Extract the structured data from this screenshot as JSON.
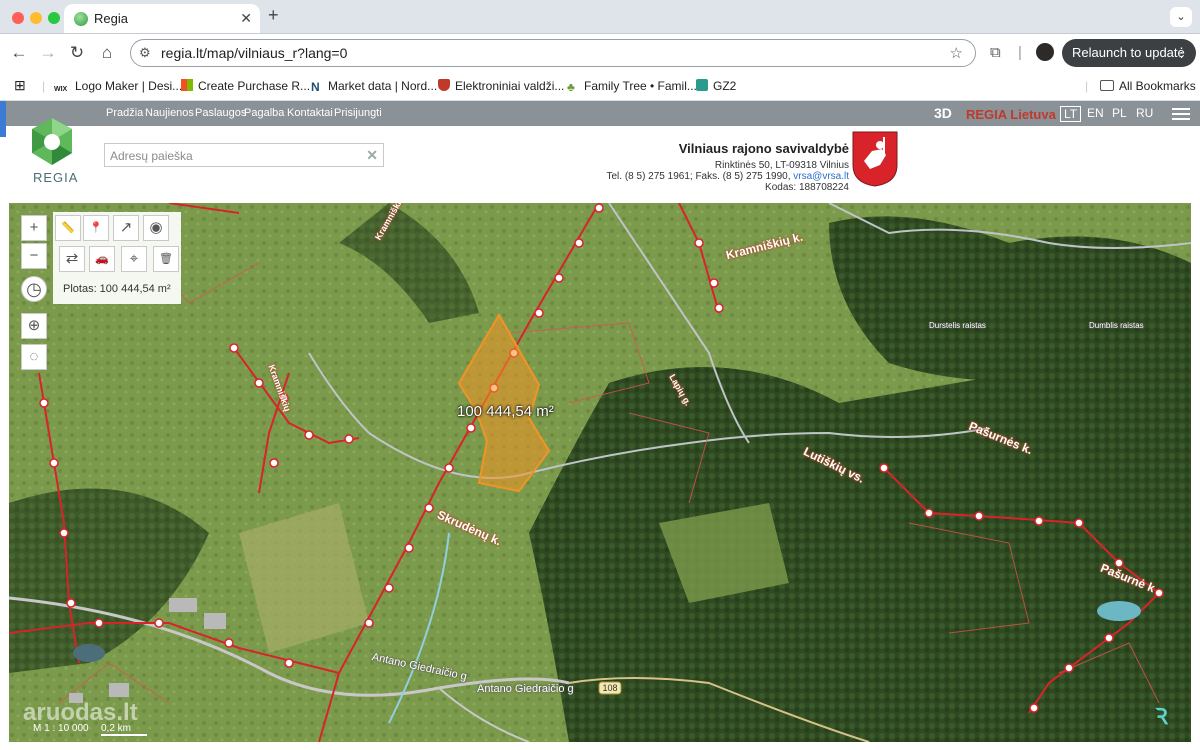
{
  "browser": {
    "tab_title": "Regia",
    "tab_close": "✕",
    "new_tab": "+",
    "url": "regia.lt/map/vilniaus_r?lang=0",
    "relaunch_label": "Relaunch to update",
    "bookmarks": [
      {
        "label": "Logo Maker | Desi..."
      },
      {
        "label": "Create Purchase R..."
      },
      {
        "label": "Market data | Nord..."
      },
      {
        "label": "Elektroniniai valdži..."
      },
      {
        "label": "Family Tree • Famil..."
      },
      {
        "label": "GZ2"
      }
    ],
    "all_bookmarks": "All Bookmarks"
  },
  "site": {
    "nav": [
      "Pradžia",
      "Naujienos",
      "Paslaugos",
      "Pagalba",
      "Kontaktai",
      "Prisijungti"
    ],
    "mode_3d": "3D",
    "region": "REGIA Lietuva",
    "languages": [
      "LT",
      "EN",
      "PL",
      "RU"
    ],
    "logo_text": "REGIA",
    "search_placeholder": "Adresų paieška",
    "municipality": {
      "name": "Vilniaus rajono savivaldybė",
      "address": "Rinktinės 50, LT-09318 Vilnius",
      "phone": "Tel. (8 5) 275 1961; Faks. (8 5) 275 1990,",
      "email": "vrsa@vrsa.lt",
      "code": "Kodas: 188708224"
    }
  },
  "map": {
    "plotas": "Plotas: 100 444,54 m²",
    "area_label": "100 444,54 m²",
    "places": [
      "Kramniškių k.",
      "Pašurnės k.",
      "Lutiškių vs.",
      "Skrudėnų k.",
      "Pašurnė k",
      "Kramniškių",
      "Kramniškių",
      "Lapių g."
    ],
    "roads": [
      "Antano Giedraičio g",
      "Antano Giedraičio g"
    ],
    "road_badge": "108",
    "scale": "M 1 : 10 000",
    "scale_bar": "0,2 km",
    "watermark": "aruodas.lt",
    "tool_icons": {
      "zoom_in": "+",
      "zoom_out": "−",
      "ruler": "📏",
      "pin": "📍",
      "share": "↗",
      "record": "◉",
      "measure_line": "⇄",
      "car": "🚗",
      "area_tool": "⌖",
      "trash": "🗑",
      "clock": "◷",
      "target": "⊕",
      "lasso": "◌"
    },
    "marsh_labels": [
      "Durstelis raistas",
      "Dumblis raistas"
    ]
  }
}
